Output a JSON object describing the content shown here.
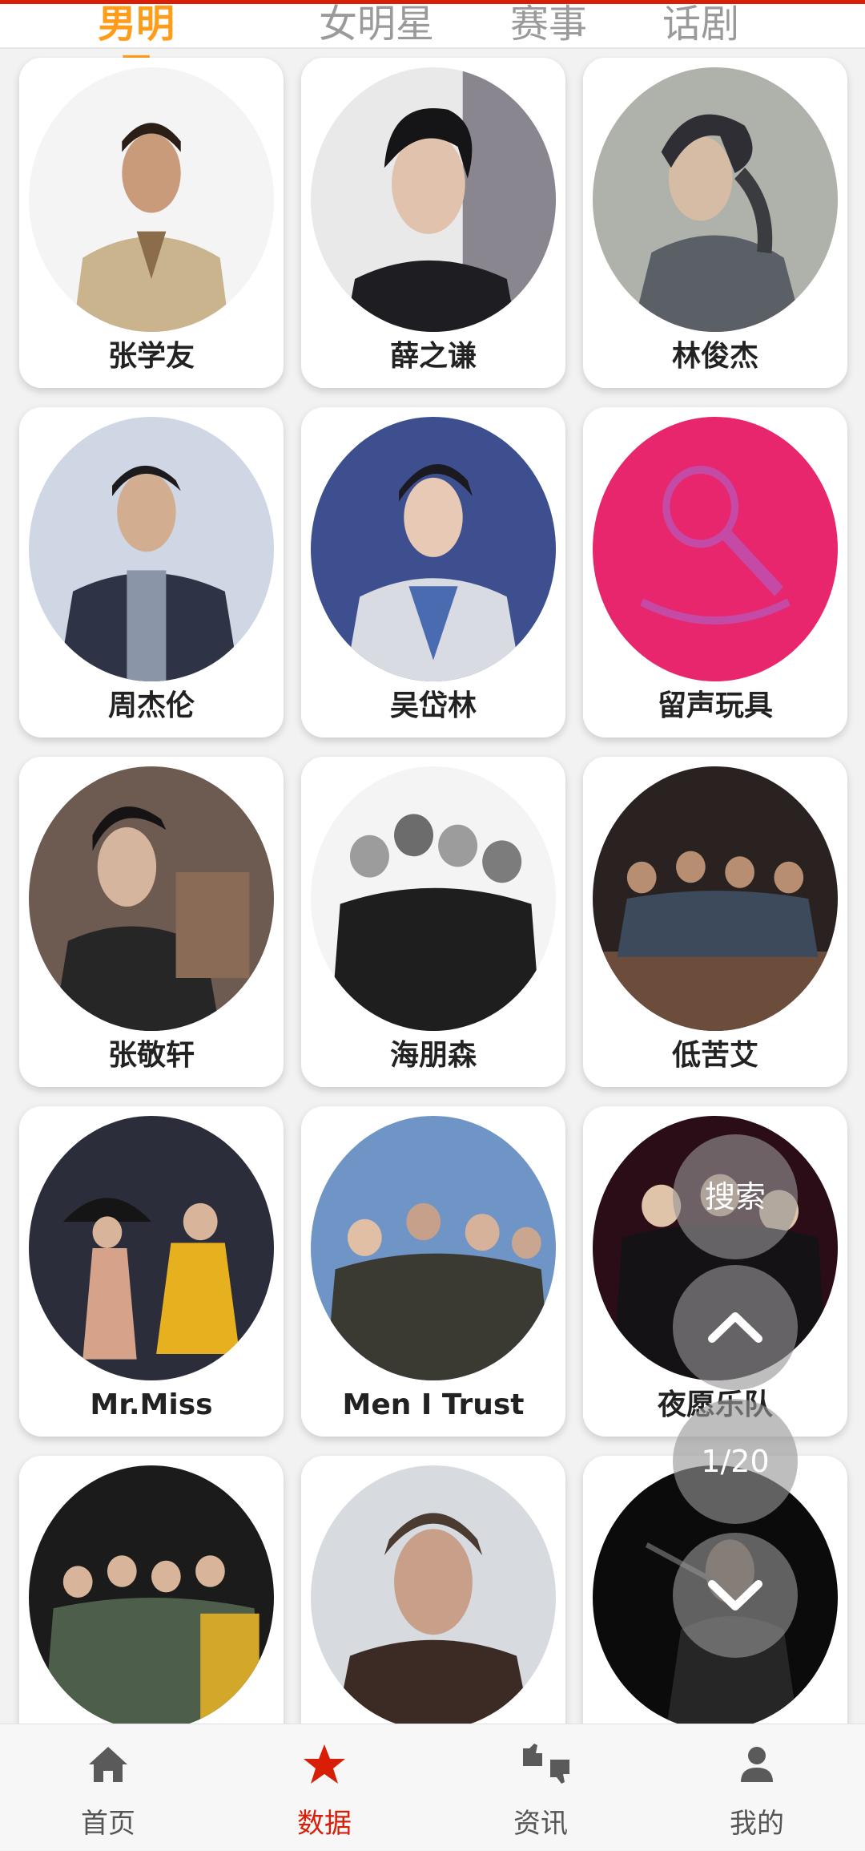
{
  "tabs": [
    "男明星",
    "女明星",
    "赛事",
    "话剧"
  ],
  "active_tab": 0,
  "cards": [
    {
      "name": "张学友"
    },
    {
      "name": "薛之谦"
    },
    {
      "name": "林俊杰"
    },
    {
      "name": "周杰伦"
    },
    {
      "name": "吴岱林"
    },
    {
      "name": "留声玩具"
    },
    {
      "name": "张敬轩"
    },
    {
      "name": "海朋森"
    },
    {
      "name": "低苦艾"
    },
    {
      "name": "Mr.Miss"
    },
    {
      "name": "Men I Trust"
    },
    {
      "name": "夜愿乐队"
    },
    {
      "name": ""
    },
    {
      "name": ""
    },
    {
      "name": ""
    }
  ],
  "float": {
    "search_label": "搜索",
    "page_indicator": "1/20"
  },
  "bottom_nav": [
    {
      "label": "首页",
      "icon": "home-icon"
    },
    {
      "label": "数据",
      "icon": "star-icon"
    },
    {
      "label": "资讯",
      "icon": "thumbs-icon"
    },
    {
      "label": "我的",
      "icon": "user-icon"
    }
  ],
  "colors": {
    "accent_red": "#d81e06",
    "active_tab_orange": "#ff9c1a",
    "placeholder_pink": "#e8266e"
  }
}
